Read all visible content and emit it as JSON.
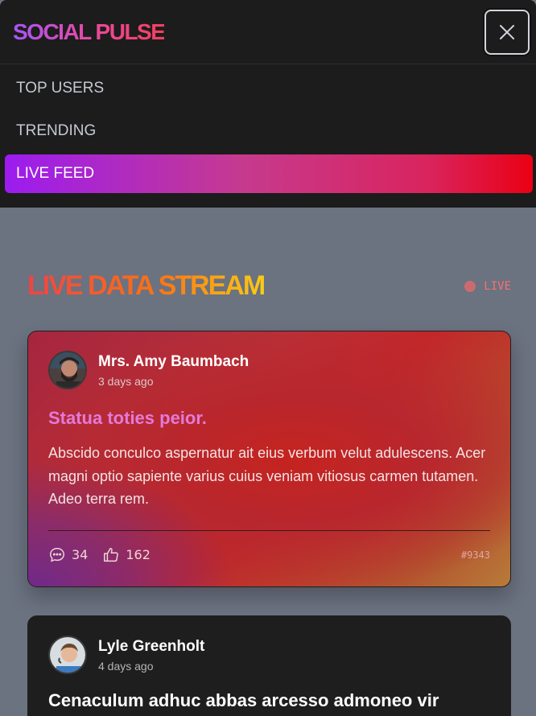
{
  "app": {
    "brand": "SOCIAL PULSE"
  },
  "nav": {
    "items": [
      {
        "label": "TOP USERS",
        "active": false
      },
      {
        "label": "TRENDING",
        "active": false
      },
      {
        "label": "LIVE FEED",
        "active": true
      }
    ]
  },
  "close_icon": "close-icon",
  "section": {
    "title": "LIVE DATA STREAM",
    "live_label": "LIVE"
  },
  "colors": {
    "background": "#6b7280",
    "nav_bg": "#1c1c1c",
    "active_start": "#9b1cf0",
    "active_end": "#ea0014",
    "live": "#f87171"
  },
  "posts": [
    {
      "author": "Mrs. Amy Baumbach",
      "time": "3 days ago",
      "title": "Statua toties peior.",
      "body": "Abscido conculco aspernatur ait eius verbum velut adulescens. Acer magni optio sapiente varius cuius veniam vitiosus carmen tutamen. Adeo terra rem.",
      "comments": "34",
      "likes": "162",
      "id": "#9343"
    },
    {
      "author": "Lyle Greenholt",
      "time": "4 days ago",
      "title": "Cenaculum adhuc abbas arcesso admoneo vir"
    }
  ]
}
